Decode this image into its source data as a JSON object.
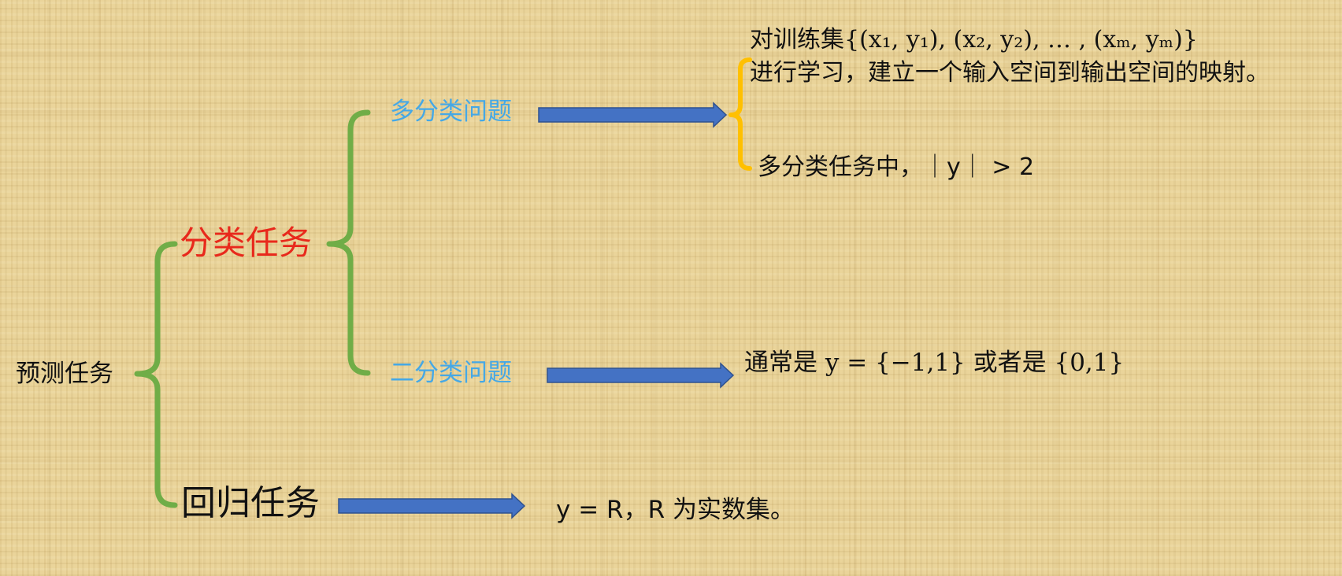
{
  "root": {
    "label": "预测任务"
  },
  "classification": {
    "label": "分类任务",
    "multi": {
      "label": "多分类问题",
      "definition": {
        "line1": "对训练集{(x₁, y₁), (x₂, y₂), … , (xₘ, yₘ)}",
        "line2": "进行学习，建立一个输入空间到输出空间的映射。"
      },
      "note": "多分类任务中，｜y｜ > 2"
    },
    "binary": {
      "label": "二分类问题",
      "note": "通常是 y = {−1,1} 或者是 {0,1}"
    }
  },
  "regression": {
    "label": "回归任务",
    "note": "y = R，R 为实数集。"
  },
  "colors": {
    "background": "#ead49a",
    "brace_green": "#70ad47",
    "brace_orange": "#ffc000",
    "arrow_blue": "#4472c4",
    "arrow_outline": "#2f528f",
    "classification_text": "#e8291c",
    "subtask_text": "#45a8e6",
    "body_text": "#111111"
  }
}
